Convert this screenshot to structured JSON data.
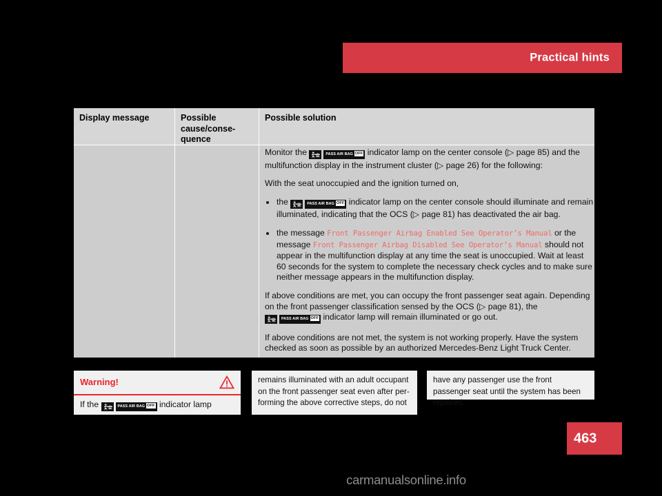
{
  "header": {
    "title": "Practical hints"
  },
  "table": {
    "columns": [
      {
        "header": "Display message"
      },
      {
        "header": "Possible cause/conse-quence"
      },
      {
        "header": "Possible solution"
      }
    ],
    "solution": {
      "intro_pre": "Monitor the",
      "intro_post": "indicator lamp on the center console (▷ page 85) and the multifunction display in the instrument cluster (▷ page 26) for the following:",
      "condition_line": "With the seat unoccupied and the ignition turned on,",
      "bullets": [
        {
          "pre": "the",
          "post": "indicator lamp on the center console should illuminate and remain illuminated, indicating that the OCS (▷ page 81) has deactivated the air bag."
        },
        {
          "pre": "the message",
          "message_1": "Front Passenger Airbag Enabled See Operator’s Manual",
          "mid": "or the message",
          "message_2": "Front Passenger Airbag Disabled See Operator’s Manual",
          "post": "should not appear in the multifunction display at any time the seat is unoccupied. Wait at least 60 seconds for the system to complete the necessary check cycles and to make sure neither message appears in the multifunction display."
        }
      ],
      "closing_pre": "If above conditions are met, you can occupy the front passenger seat again. Depending on the front passenger classification sensed by the OCS (▷ page 81), the",
      "closing_post": "indicator lamp will remain illuminated or go out.",
      "final": "If above conditions are not met, the system is not working properly. Have the system checked as soon as possible by an authorized Mercedes-Benz Light Truck Center."
    }
  },
  "warning": {
    "title": "Warning!",
    "body_pre": "If the",
    "body_post": "indicator lamp"
  },
  "continuation": {
    "box_1": "remains illuminated with an adult occupant on the front passenger seat even after per-forming the above corrective steps, do not",
    "box_2": "have any passenger use the front passenger seat until the system has been repaired."
  },
  "page_number": "463",
  "watermark": "carmanualsonline.info",
  "icon": {
    "airbag_label": "PASS AIR BAG",
    "airbag_state": "OFF"
  },
  "colors": {
    "accent_red": "#d63a45",
    "warning_red": "#e8252c",
    "message_red": "#ef6a6a",
    "table_bg": "#cdcdcd",
    "table_header_bg": "#d6d6d6",
    "box_bg": "#f0f0f0"
  }
}
